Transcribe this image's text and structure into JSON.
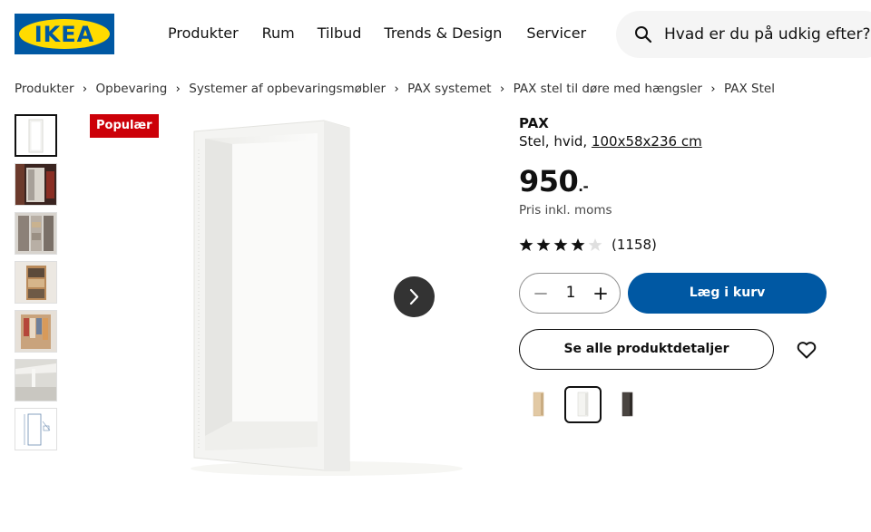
{
  "header": {
    "logo_text": "IKEA",
    "nav": [
      "Produkter",
      "Rum",
      "Tilbud",
      "Trends & Design",
      "Servicer"
    ],
    "search": {
      "placeholder": "Hvad er du på udkig efter?",
      "icon": "search-icon"
    }
  },
  "breadcrumb": [
    "Produkter",
    "Opbevaring",
    "Systemer af opbevaringsmøbler",
    "PAX systemet",
    "PAX stel til døre med hængsler",
    "PAX Stel"
  ],
  "gallery": {
    "badge": "Populær",
    "thumbnail_count": 7,
    "next_icon": "chevron-right-icon"
  },
  "product": {
    "name": "PAX",
    "description_prefix": "Stel, hvid, ",
    "dimensions": "100x58x236 cm",
    "price": "950",
    "price_suffix": ".-",
    "price_note": "Pris inkl. moms",
    "rating_value": 4,
    "rating_max": 5,
    "review_count": "(1158)"
  },
  "purchase": {
    "quantity": "1",
    "add_to_cart": "Læg i kurv",
    "details": "Se alle produktdetaljer"
  },
  "variants": [
    "oak-effect",
    "white",
    "black-brown"
  ],
  "colors": {
    "brand_blue": "#0058a3",
    "brand_yellow": "#ffdb00",
    "badge_red": "#cc0008"
  }
}
